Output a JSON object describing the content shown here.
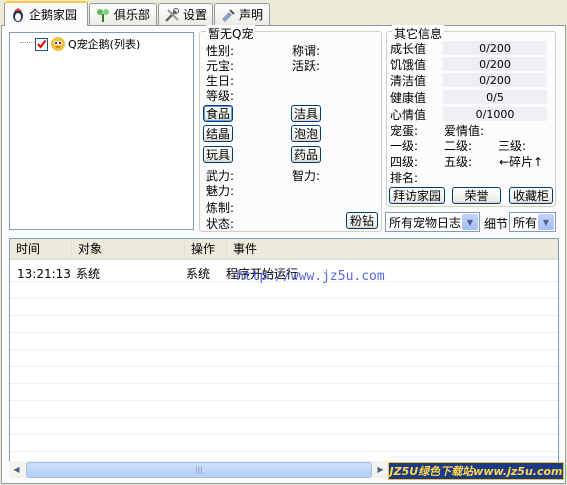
{
  "tabs": [
    {
      "label": "企鹅家园",
      "icon": "penguin-icon"
    },
    {
      "label": "俱乐部",
      "icon": "club-icon"
    },
    {
      "label": "设置",
      "icon": "tools-icon"
    },
    {
      "label": "声明",
      "icon": "statement-icon"
    }
  ],
  "tree": {
    "root_label": "Q宠企鹅(列表)"
  },
  "pet_info": {
    "title": "暂无Q宠",
    "gender": "性别:",
    "title_label": "称谓:",
    "yuanbao": "元宝:",
    "active": "活跃:",
    "birthday": "生日:",
    "level": "等级:",
    "martial": "武力:",
    "intellect": "智力:",
    "charm": "魅力:",
    "refine": "炼制:",
    "status": "状态:",
    "buttons": {
      "food": "食品",
      "clean": "洁具",
      "crystal": "结晶",
      "bubble": "泡泡",
      "toy": "玩具",
      "medicine": "药品",
      "pink_diamond": "粉钻"
    }
  },
  "other_info": {
    "title": "其它信息",
    "bars": [
      {
        "label": "成长值",
        "value": "0/200"
      },
      {
        "label": "饥饿值",
        "value": "0/200"
      },
      {
        "label": "清洁值",
        "value": "0/200"
      },
      {
        "label": "健康值",
        "value": "0/5"
      },
      {
        "label": "心情值",
        "value": "0/1000"
      }
    ],
    "egg": "宠蛋:",
    "love": "爱情值:",
    "lv1": "一级:",
    "lv2": "二级:",
    "lv3": "三级:",
    "lv4": "四级:",
    "lv5": "五级:",
    "fragment": "←碎片↑",
    "rank": "排名:",
    "buttons": {
      "visit": "拜访家园",
      "honor": "荣誉",
      "collection": "收藏柜"
    }
  },
  "filters": {
    "log_select": "所有宠物日志",
    "detail_label": "细节",
    "detail_select": "所有"
  },
  "log": {
    "columns": [
      "时间",
      "对象",
      "操作",
      "事件"
    ],
    "rows": [
      {
        "time": "13:21:13",
        "object": "系统",
        "action": "系统",
        "event": "程序开始运行"
      }
    ]
  },
  "watermark": {
    "url": "http://www.jz5u.com",
    "banner": "JZ5U绿色下载站www.jz5u.com"
  }
}
